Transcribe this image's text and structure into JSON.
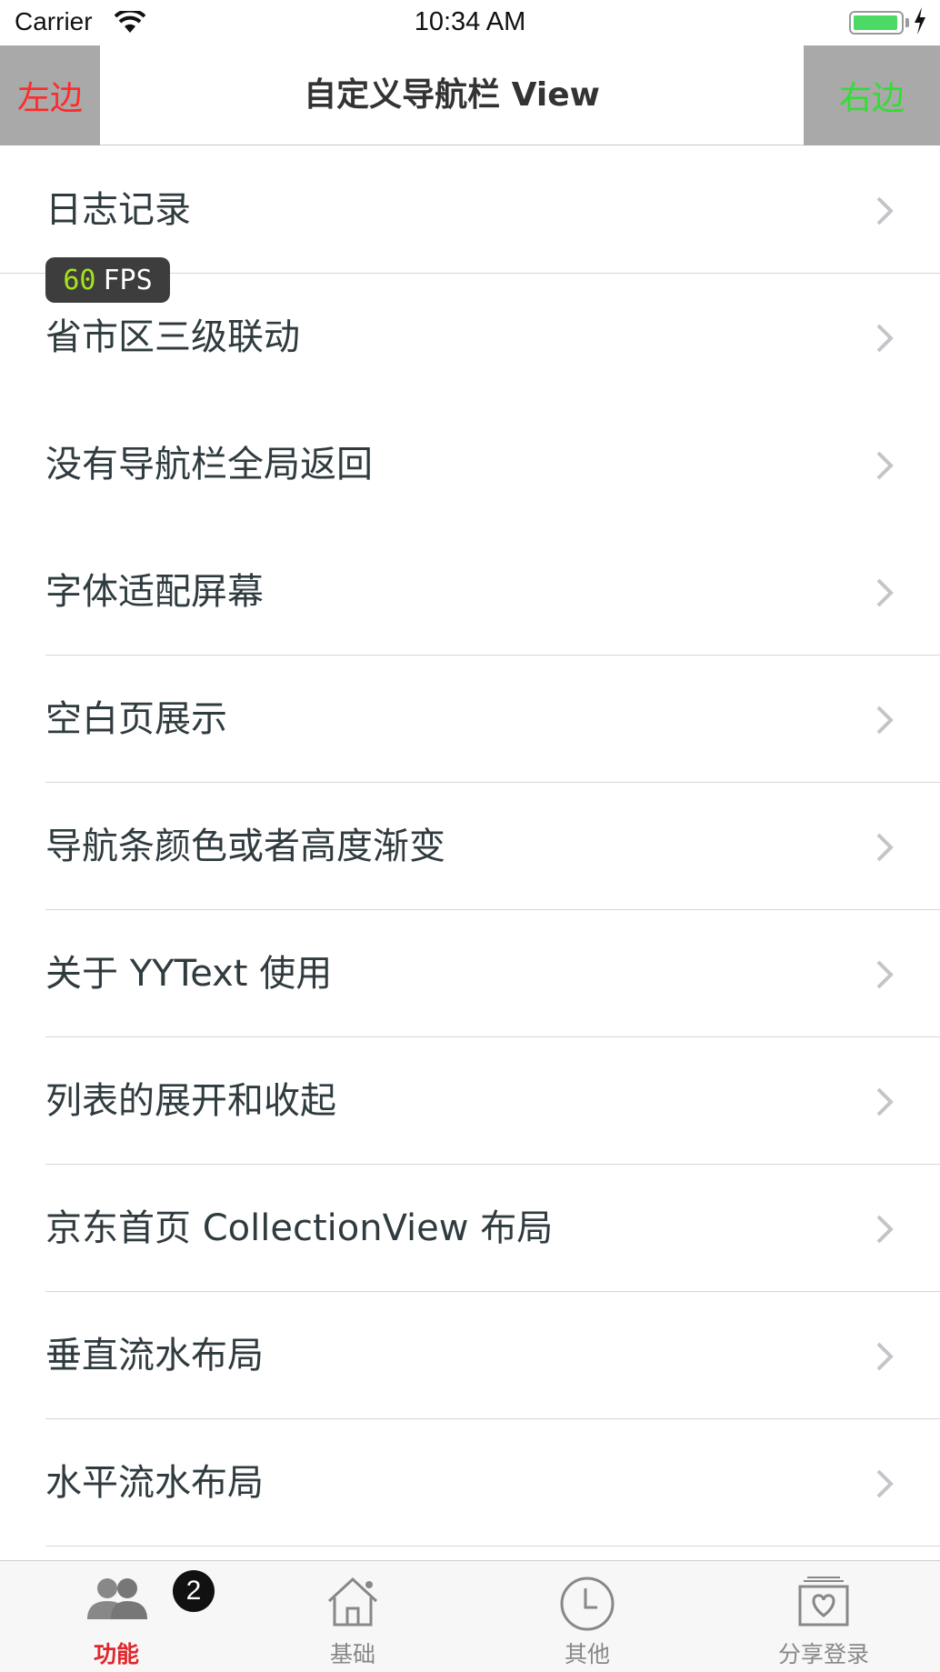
{
  "status_bar": {
    "carrier": "Carrier",
    "time": "10:34 AM",
    "battery_color": "#4cd964"
  },
  "nav_bar": {
    "left_label": "左边",
    "title": "自定义导航栏 View",
    "right_label": "右边",
    "left_color": "#ff2a2a",
    "right_color": "#33dd33",
    "button_bg": "#a9a9a9"
  },
  "fps_badge": {
    "value": "60",
    "unit": "FPS"
  },
  "list": {
    "items": [
      {
        "label": "日志记录"
      },
      {
        "label": "省市区三级联动"
      },
      {
        "label": "没有导航栏全局返回"
      },
      {
        "label": "字体适配屏幕"
      },
      {
        "label": "空白页展示"
      },
      {
        "label": "导航条颜色或者高度渐变"
      },
      {
        "label": "关于 YYText 使用"
      },
      {
        "label": "列表的展开和收起"
      },
      {
        "label": "京东首页 CollectionView 布局"
      },
      {
        "label": "垂直流水布局"
      },
      {
        "label": "水平流水布局"
      }
    ],
    "chevron_icon": "chevron-right-icon"
  },
  "tab_bar": {
    "tabs": [
      {
        "label": "功能",
        "icon": "people-icon",
        "active": true,
        "badge": "2"
      },
      {
        "label": "基础",
        "icon": "house-icon",
        "active": false
      },
      {
        "label": "其他",
        "icon": "clock-icon",
        "active": false
      },
      {
        "label": "分享登录",
        "icon": "gift-box-icon",
        "active": false
      }
    ],
    "active_color": "#e0252b"
  }
}
